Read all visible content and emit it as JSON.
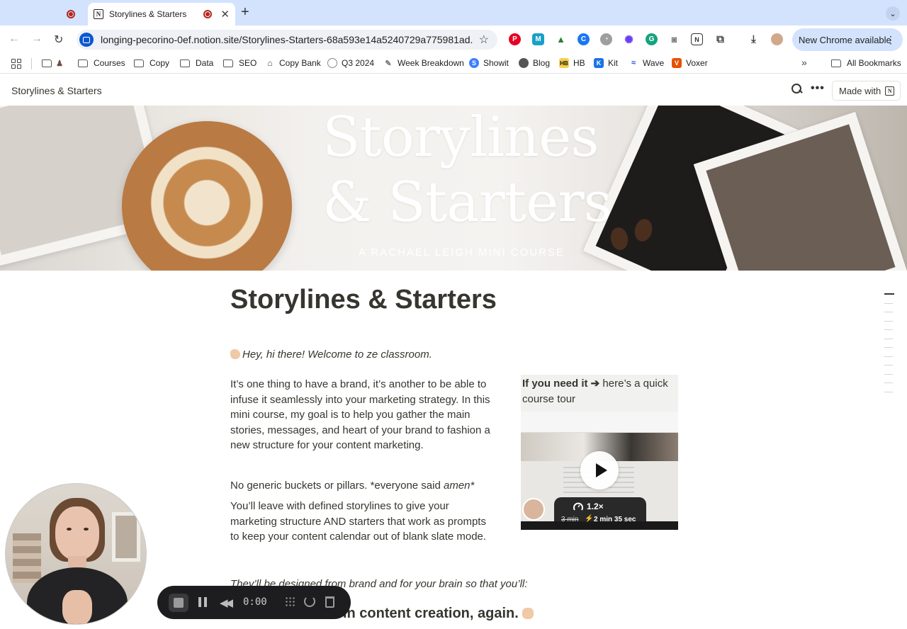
{
  "browser": {
    "tabs": [
      {
        "label": "",
        "recording": true,
        "active": false
      },
      {
        "label": "Storylines & Starters",
        "recording": true,
        "active": true
      }
    ],
    "new_tab_icon": "plus-icon",
    "url": "longing-pecorino-0ef.notion.site/Storylines-Starters-68a593e14a5240729a775981ad...",
    "new_chrome_label": "New Chrome available",
    "bookmarks": [
      {
        "label": "",
        "icon": "folder-icon"
      },
      {
        "label": "Courses",
        "icon": "folder-icon"
      },
      {
        "label": "Copy",
        "icon": "folder-icon"
      },
      {
        "label": "Data",
        "icon": "folder-icon"
      },
      {
        "label": "SEO",
        "icon": "folder-icon"
      },
      {
        "label": "Copy Bank",
        "icon": "bank-icon"
      },
      {
        "label": "Q3 2024",
        "icon": "globe-icon"
      },
      {
        "label": "Week Breakdown",
        "icon": "edit-icon"
      },
      {
        "label": "Showit",
        "icon": "showit-icon"
      },
      {
        "label": "Blog",
        "icon": "globe-icon"
      },
      {
        "label": "HB",
        "icon": "hb-icon"
      },
      {
        "label": "Kit",
        "icon": "kit-icon"
      },
      {
        "label": "Wave",
        "icon": "wave-icon"
      },
      {
        "label": "Voxer",
        "icon": "voxer-icon"
      }
    ],
    "all_bookmarks_label": "All Bookmarks"
  },
  "notion": {
    "breadcrumb": "Storylines & Starters",
    "made_with_label": "Made with"
  },
  "cover": {
    "title_line1": "Storylines",
    "title_line2": "& Starters",
    "subtitle": "A RACHAEL LEIGH MINI COURSE"
  },
  "page": {
    "title": "Storylines & Starters",
    "greeting": "Hey, hi there! Welcome to ze classroom.",
    "intro": "It’s one thing to have a brand, it’s another to be able to infuse it seamlessly into your marketing strategy. In this mini course, my goal is to help you gather the main stories, messages, and heart of your brand to fashion a new structure for your content marketing.",
    "no_generic_before": "No generic buckets or pillars. *everyone said ",
    "no_generic_italic": "amen*",
    "outcome": "You’ll leave with defined storylines to give your marketing structure AND starters that work as prompts to keep your content calendar out of blank slate mode.",
    "designed": "They’ll be designed from brand and for your brain so that you’ll:",
    "bottom_heading": "Never feel stuck in content creation, again."
  },
  "callout": {
    "bold": "If you need it ➔",
    "rest": " here’s a quick course tour"
  },
  "video": {
    "speed": "1.2×",
    "original_time": "3 min",
    "new_time": "2 min 35 sec"
  },
  "recorder": {
    "time": "0:00"
  }
}
